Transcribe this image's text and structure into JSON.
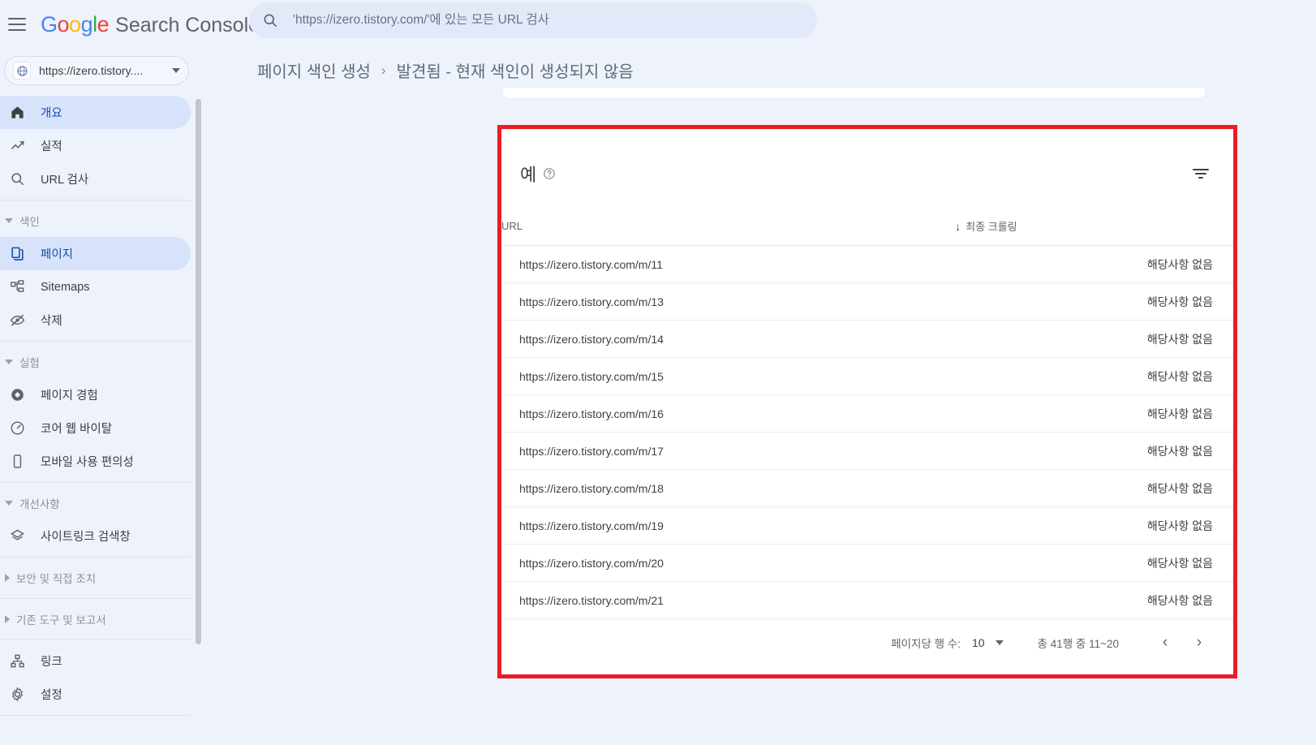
{
  "topbar": {
    "menu_icon": "hamburger-menu-icon",
    "logo_letters": [
      "G",
      "o",
      "o",
      "g",
      "l",
      "e"
    ],
    "brand_text": "Search Console",
    "search": {
      "icon": "search-icon",
      "placeholder": "'https://izero.tistory.com/'에 있는 모든 URL 검사",
      "value": ""
    }
  },
  "property": {
    "icon": "globe-icon",
    "label": "https://izero.tistory....",
    "caret": "chevron-down-icon"
  },
  "breadcrumb": {
    "parent": "페이지 색인 생성",
    "separator": "›",
    "current": "발견됨 - 현재 색인이 생성되지 않음"
  },
  "sidebar": {
    "items": [
      {
        "label": "개요",
        "icon": "home-icon",
        "active": true,
        "type": "item"
      },
      {
        "label": "실적",
        "icon": "trending-up-icon",
        "active": false,
        "type": "item"
      },
      {
        "label": "URL 검사",
        "icon": "search-icon",
        "active": false,
        "type": "item"
      },
      {
        "label": "색인",
        "icon": "chevron-down-icon",
        "type": "group"
      },
      {
        "label": "페이지",
        "icon": "pages-copy-icon",
        "active": true,
        "type": "item"
      },
      {
        "label": "Sitemaps",
        "icon": "sitemap-icon",
        "active": false,
        "type": "item"
      },
      {
        "label": "삭제",
        "icon": "eye-off-icon",
        "active": false,
        "type": "item"
      },
      {
        "label": "실험",
        "icon": "chevron-down-icon",
        "type": "group"
      },
      {
        "label": "페이지 경험",
        "icon": "page-experience-icon",
        "active": false,
        "type": "item"
      },
      {
        "label": "코어 웹 바이탈",
        "icon": "speedometer-icon",
        "active": false,
        "type": "item"
      },
      {
        "label": "모바일 사용 편의성",
        "icon": "mobile-phone-icon",
        "active": false,
        "type": "item"
      },
      {
        "label": "개선사항",
        "icon": "chevron-down-icon",
        "type": "group"
      },
      {
        "label": "사이트링크 검색창",
        "icon": "layers-icon",
        "active": false,
        "type": "item"
      },
      {
        "label": "보안 및 직접 조치",
        "icon": "chevron-right-icon",
        "type": "group-collapsed"
      },
      {
        "label": "기존 도구 및 보고서",
        "icon": "chevron-right-icon",
        "type": "group-collapsed"
      },
      {
        "label": "링크",
        "icon": "links-icon",
        "active": false,
        "type": "item"
      },
      {
        "label": "설정",
        "icon": "gear-icon",
        "active": false,
        "type": "item"
      }
    ]
  },
  "card": {
    "title": "예",
    "help_icon": "help-circle-icon",
    "filter_icon": "filter-icon",
    "table": {
      "columns": [
        {
          "key": "url",
          "label": "URL",
          "align": "left"
        },
        {
          "key": "crawl",
          "label": "최종 크롤링",
          "align": "right",
          "sort": "desc",
          "sort_icon": "arrow-down-icon"
        }
      ],
      "rows": [
        {
          "url": "https://izero.tistory.com/m/11",
          "crawl": "해당사항 없음"
        },
        {
          "url": "https://izero.tistory.com/m/13",
          "crawl": "해당사항 없음"
        },
        {
          "url": "https://izero.tistory.com/m/14",
          "crawl": "해당사항 없음"
        },
        {
          "url": "https://izero.tistory.com/m/15",
          "crawl": "해당사항 없음"
        },
        {
          "url": "https://izero.tistory.com/m/16",
          "crawl": "해당사항 없음"
        },
        {
          "url": "https://izero.tistory.com/m/17",
          "crawl": "해당사항 없음"
        },
        {
          "url": "https://izero.tistory.com/m/18",
          "crawl": "해당사항 없음"
        },
        {
          "url": "https://izero.tistory.com/m/19",
          "crawl": "해당사항 없음"
        },
        {
          "url": "https://izero.tistory.com/m/20",
          "crawl": "해당사항 없음"
        },
        {
          "url": "https://izero.tistory.com/m/21",
          "crawl": "해당사항 없음"
        }
      ]
    },
    "footer": {
      "rows_per_page_label": "페이지당 행 수:",
      "rows_per_page_value": "10",
      "rows_per_page_caret": "chevron-down-icon",
      "range_label": "총 41행 중 11~20",
      "prev_icon": "chevron-left-icon",
      "next_icon": "chevron-right-icon"
    }
  },
  "colors": {
    "highlight": "#ed1c24",
    "page_bg": "#eef2fb",
    "active_nav": "#d7e3fb",
    "card_bg": "#ffffff"
  }
}
